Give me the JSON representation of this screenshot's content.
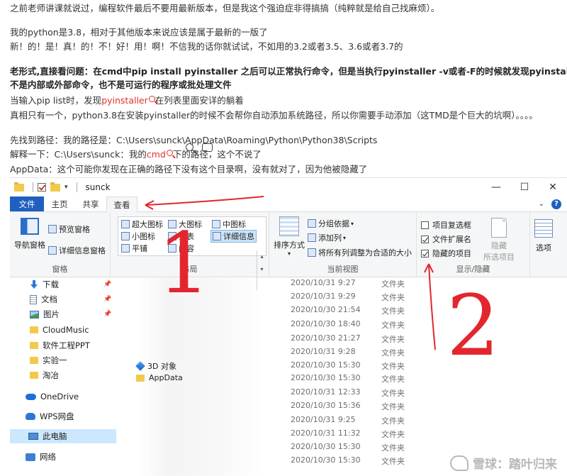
{
  "article": {
    "line1": "之前老师讲课就说过，编程软件最后不要用最新版本，但是我这个强迫症非得搞搞（纯粹就是给自己找麻烦）。",
    "line2": "我的python是3.8，相对于其他版本来说应该是属于最新的一版了",
    "line3": "新！的！是！真！的！不！好！用！啊！不信我的话你就试试，不如用的3.2或者3.5、3.6或者3.7的",
    "line4": "老形式,直接看问题：在cmd中pip install pyinstaller 之后可以正常执行命令，但是当执行pyinstaller -v或者-F的时候就发现pyinstaller",
    "line5": "不是内部或外部命令，也不是可运行的程序或批处理文件",
    "line6_a": "当输入pip list时，发现",
    "line6_link": "pyinstaller",
    "line6_b": "在列表里面安详的躺着",
    "line7": "真相只有一个，python3.8在安装pyinstaller的时候不会帮你自动添加系统路径，所以你需要手动添加（这TMD是个巨大的坑啊）。。。。",
    "line8": "先找到路径：我的路径是：C:\\Users\\sunck\\AppData\\Roaming\\Python\\Python38\\Scripts",
    "line9_a": "解释一下：C:\\Users\\sunck：我的",
    "line9_link": "cmd",
    "line9_b": "下的路径，这个不说了",
    "line10": "AppData：这个可能你发现在正确的路径下没有这个目录啊，没有就对了，因为他被隐藏了"
  },
  "window": {
    "title": "sunck",
    "controls": {
      "minimize": "—",
      "maximize": "☐",
      "close": "✕"
    },
    "tabs": [
      "文件",
      "主页",
      "共享",
      "查看"
    ],
    "help": "?"
  },
  "ribbon": {
    "pane_group": {
      "title": "窗格",
      "nav_pane": "导航窗格",
      "preview_pane": "预览窗格",
      "details_pane": "详细信息窗格"
    },
    "layout_group": {
      "title": "布局",
      "items": [
        "超大图标",
        "大图标",
        "中图标",
        "小图标",
        "列表",
        "详细信息",
        "平铺",
        "内容"
      ]
    },
    "view_group": {
      "title": "当前视图",
      "sort": "排序方式",
      "group_by": "分组依据",
      "add_column": "添加列",
      "fit_columns": "将所有列调整为合适的大小"
    },
    "show_group": {
      "title": "显示/隐藏",
      "item_checkbox": "项目复选框",
      "file_ext": "文件扩展名",
      "hidden_items": "隐藏的项目",
      "hide": "隐藏",
      "selected_items": "所选项目",
      "options": "选项"
    }
  },
  "nav": [
    {
      "label": "下载",
      "icon": "download-icon",
      "pinned": true
    },
    {
      "label": "文档",
      "icon": "document-icon",
      "pinned": true
    },
    {
      "label": "图片",
      "icon": "picture-icon",
      "pinned": true
    },
    {
      "label": "CloudMusic",
      "icon": "folder-icon"
    },
    {
      "label": "软件工程PPT",
      "icon": "folder-icon"
    },
    {
      "label": "实验一",
      "icon": "folder-icon"
    },
    {
      "label": "淘冶",
      "icon": "folder-icon"
    },
    {
      "label": "OneDrive",
      "icon": "cloud-icon"
    },
    {
      "label": "WPS网盘",
      "icon": "wps-cloud-icon"
    },
    {
      "label": "此电脑",
      "icon": "computer-icon"
    },
    {
      "label": "网络",
      "icon": "network-icon"
    }
  ],
  "files": [
    {
      "name": "",
      "date": "2020/10/31 9:27",
      "type": "文件夹"
    },
    {
      "name": "",
      "date": "2020/10/31 9:29",
      "type": "文件夹"
    },
    {
      "name": "",
      "date": "2020/10/30 21:54",
      "type": "文件夹"
    },
    {
      "name": "",
      "date": "2020/10/30 18:40",
      "type": "文件夹"
    },
    {
      "name": "",
      "date": "2020/10/30 21:27",
      "type": "文件夹"
    },
    {
      "name": "",
      "date": "2020/10/31 9:28",
      "type": "文件夹"
    },
    {
      "name": "3D 对象",
      "date": "2020/10/30 15:30",
      "type": "文件夹"
    },
    {
      "name": "AppData",
      "date": "2020/10/30 15:30",
      "type": "文件夹"
    },
    {
      "name": "",
      "date": "2020/10/31 12:33",
      "type": "文件夹"
    },
    {
      "name": "",
      "date": "2020/10/30 15:36",
      "type": "文件夹"
    },
    {
      "name": "",
      "date": "2020/10/31 9:25",
      "type": "文件夹"
    },
    {
      "name": "",
      "date": "2020/10/31 11:32",
      "type": "文件夹"
    },
    {
      "name": "",
      "date": "2020/10/30 15:30",
      "type": "文件夹"
    },
    {
      "name": "",
      "date": "2020/10/30 15:30",
      "type": "文件夹"
    }
  ],
  "annotations": {
    "step1": "1",
    "step2": "2",
    "color": "#e3262e"
  },
  "watermark": "雪球：踏叶归来"
}
